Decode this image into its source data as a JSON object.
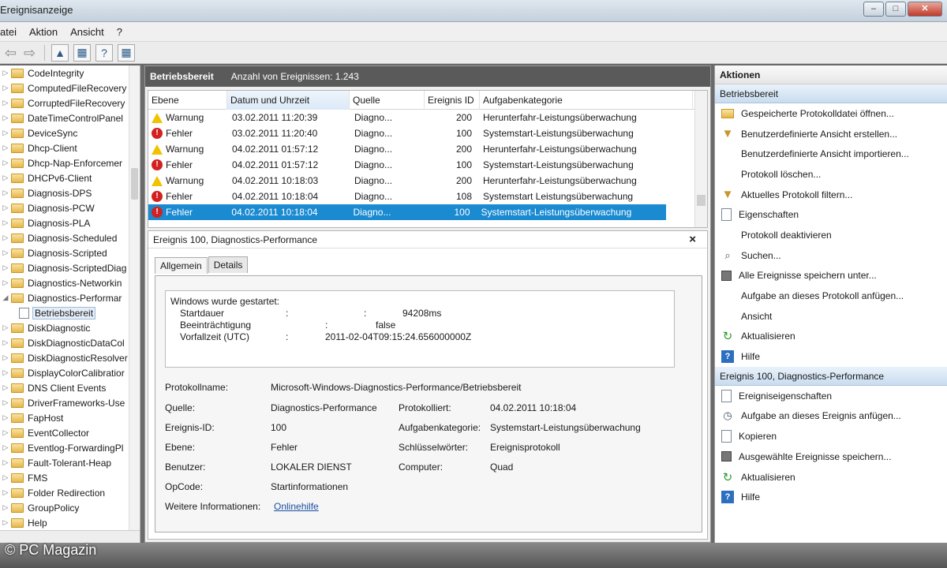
{
  "window": {
    "title": "Ereignisanzeige",
    "buttons": [
      "–",
      "□",
      "✕"
    ]
  },
  "menu": [
    "atei",
    "Aktion",
    "Ansicht",
    "?"
  ],
  "tree": {
    "items": [
      "CodeIntegrity",
      "ComputedFileRecovery",
      "CorruptedFileRecovery",
      "DateTimeControlPanel",
      "DeviceSync",
      "Dhcp-Client",
      "Dhcp-Nap-Enforcemer",
      "DHCPv6-Client",
      "Diagnosis-DPS",
      "Diagnosis-PCW",
      "Diagnosis-PLA",
      "Diagnosis-Scheduled",
      "Diagnosis-Scripted",
      "Diagnosis-ScriptedDiag",
      "Diagnostics-Networkin",
      "Diagnostics-Performar"
    ],
    "child": "Betriebsbereit",
    "items_after": [
      "DiskDiagnostic",
      "DiskDiagnosticDataCol",
      "DiskDiagnosticResolver",
      "DisplayColorCalibratior",
      "DNS Client Events",
      "DriverFrameworks-Use",
      "FapHost",
      "EventCollector",
      "Eventlog-ForwardingPl",
      "Fault-Tolerant-Heap",
      "FMS",
      "Folder Redirection",
      "GroupPolicy",
      "Help"
    ]
  },
  "center": {
    "header_title": "Betriebsbereit",
    "header_count": "Anzahl von Ereignissen: 1.243",
    "columns": [
      "Ebene",
      "Datum und Uhrzeit",
      "Quelle",
      "Ereignis ID",
      "Aufgabenkategorie"
    ],
    "rows": [
      {
        "level": "Warnung",
        "type": "warn",
        "date": "03.02.2011 11:20:39",
        "source": "Diagno...",
        "id": "200",
        "category": "Herunterfahr-Leistungsüberwachung"
      },
      {
        "level": "Fehler",
        "type": "err",
        "date": "03.02.2011 11:20:40",
        "source": "Diagno...",
        "id": "100",
        "category": "Systemstart-Leistungsüberwachung"
      },
      {
        "level": "Warnung",
        "type": "warn",
        "date": "04.02.2011 01:57:12",
        "source": "Diagno...",
        "id": "200",
        "category": "Herunterfahr-Leistungsüberwachung"
      },
      {
        "level": "Fehler",
        "type": "err",
        "date": "04.02.2011 01:57:12",
        "source": "Diagno...",
        "id": "100",
        "category": "Systemstart-Leistungsüberwachung"
      },
      {
        "level": "Warnung",
        "type": "warn",
        "date": "04.02.2011 10:18:03",
        "source": "Diagno...",
        "id": "200",
        "category": "Herunterfahr-Leistungsüberwachung"
      },
      {
        "level": "Fehler",
        "type": "err",
        "date": "04.02.2011 10:18:04",
        "source": "Diagno...",
        "id": "108",
        "category": "Systemstart Leistungsüberwachung"
      },
      {
        "level": "Fehler",
        "type": "err",
        "date": "04.02.2011 10:18:04",
        "source": "Diagno...",
        "id": "100",
        "category": "Systemstart-Leistungsüberwachung",
        "selected": true
      }
    ]
  },
  "detail": {
    "title": "Ereignis 100, Diagnostics-Performance",
    "close": "×",
    "tabs": [
      "Allgemein",
      "Details"
    ],
    "message": {
      "line1": "Windows wurde gestartet:",
      "startdauer_label": "Startdauer",
      "startdauer_value": "94208ms",
      "beeintr_label": "Beeinträchtigung",
      "beeintr_value": "false",
      "vorfall_label": "Vorfallzeit (UTC)",
      "vorfall_value": "2011-02-04T09:15:24.656000000Z",
      "colon": ":"
    },
    "fields": {
      "protokollname_label": "Protokollname:",
      "protokollname_value": "Microsoft-Windows-Diagnostics-Performance/Betriebsbereit",
      "quelle_label": "Quelle:",
      "quelle_value": "Diagnostics-Performance",
      "protokolliert_label": "Protokolliert:",
      "protokolliert_value": "04.02.2011 10:18:04",
      "ereignisid_label": "Ereignis-ID:",
      "ereignisid_value": "100",
      "aufgabe_label": "Aufgabenkategorie:",
      "aufgabe_value": "Systemstart-Leistungsüberwachung",
      "ebene_label": "Ebene:",
      "ebene_value": "Fehler",
      "schluessel_label": "Schlüsselwörter:",
      "schluessel_value": "Ereignisprotokoll",
      "benutzer_label": "Benutzer:",
      "benutzer_value": "LOKALER DIENST",
      "computer_label": "Computer:",
      "computer_value": "Quad",
      "opcode_label": "OpCode:",
      "opcode_value": "Startinformationen",
      "weitere_label": "Weitere Informationen:",
      "weitere_link": "Onlinehilfe"
    }
  },
  "actions": {
    "title": "Aktionen",
    "section1": "Betriebsbereit",
    "items1": [
      {
        "label": "Gespeicherte Protokolldatei öffnen...",
        "icon": "folder-icon"
      },
      {
        "label": "Benutzerdefinierte Ansicht erstellen...",
        "icon": "filter-icon"
      },
      {
        "label": "Benutzerdefinierte Ansicht importieren...",
        "icon": "blank"
      },
      {
        "label": "Protokoll löschen...",
        "icon": "blank"
      },
      {
        "label": "Aktuelles Protokoll filtern...",
        "icon": "filter-icon"
      },
      {
        "label": "Eigenschaften",
        "icon": "doc-icon"
      },
      {
        "label": "Protokoll deaktivieren",
        "icon": "blank"
      },
      {
        "label": "Suchen...",
        "icon": "find-icon"
      },
      {
        "label": "Alle Ereignisse speichern unter...",
        "icon": "save-icon"
      },
      {
        "label": "Aufgabe an dieses Protokoll anfügen...",
        "icon": "blank"
      },
      {
        "label": "Ansicht",
        "icon": "blank"
      },
      {
        "label": "Aktualisieren",
        "icon": "refresh-icon"
      },
      {
        "label": "Hilfe",
        "icon": "help-icon"
      }
    ],
    "section2": "Ereignis 100, Diagnostics-Performance",
    "items2": [
      {
        "label": "Ereigniseigenschaften",
        "icon": "doc-icon"
      },
      {
        "label": "Aufgabe an dieses Ereignis anfügen...",
        "icon": "task-icon"
      },
      {
        "label": "Kopieren",
        "icon": "copy-icon"
      },
      {
        "label": "Ausgewählte Ereignisse speichern...",
        "icon": "save-icon"
      },
      {
        "label": "Aktualisieren",
        "icon": "refresh-icon"
      },
      {
        "label": "Hilfe",
        "icon": "help-icon"
      }
    ]
  },
  "watermark": "© PC Magazin"
}
